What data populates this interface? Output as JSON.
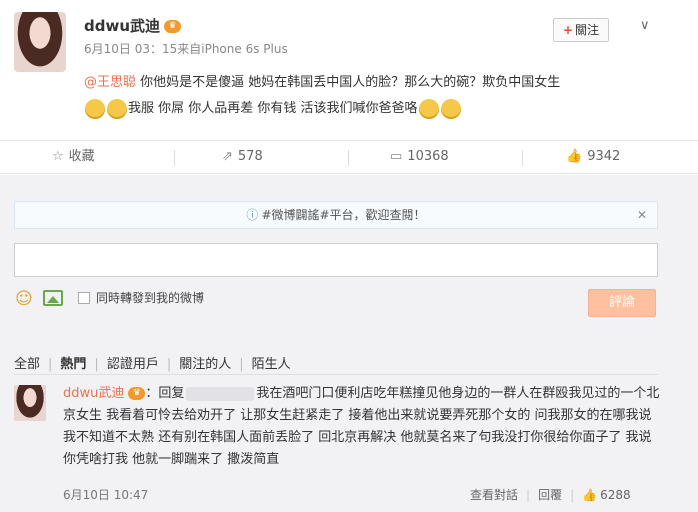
{
  "post": {
    "username": "ddwu武迪",
    "meta": "6月10日 03：15来自iPhone 6s Plus",
    "follow_label": "關注",
    "mention": "@王思聪",
    "text_part1": " 你他妈是不是傻逼 她妈在韩国丢中国人的脸？那么大的碗？欺负中国女生",
    "text_part2": "我服 你屌 你人品再差 你有钱 活该我们喊你爸爸咯"
  },
  "actions": {
    "favorite_label": "收藏",
    "repost_count": "578",
    "comment_count": "10368",
    "like_count": "9342"
  },
  "comment_box": {
    "notice": "#微博闢謠#平台，歡迎查閱！",
    "input_value": "",
    "repost_label": "同時轉發到我的微博",
    "submit_label": "評論"
  },
  "filters": [
    "全部",
    "熱門",
    "認證用戶",
    "關注的人",
    "陌生人"
  ],
  "reply": {
    "username": "ddwu武迪",
    "prefix": "：回复",
    "text": "我在酒吧门口便利店吃年糕撞见他身边的一群人在群殴我见过的一个北京女生 我看着可怜去给劝开了 让那女生赶紧走了 接着他出来就说要弄死那个女的 问我那女的在哪我说我不知道不太熟 还有别在韩国人面前丢脸了 回北京再解决 他就莫名来了句我没打你很给你面子了 我说你凭啥打我 他就一脚踹来了 撒泼简直",
    "time": "6月10日 10:47",
    "view_label": "查看對話",
    "reply_label": "回覆",
    "like_count": "6288"
  },
  "colors": {
    "accent": "#eb7350",
    "submit_bg": "#ffc09f",
    "comment_area_bg": "#f2f2f5"
  }
}
